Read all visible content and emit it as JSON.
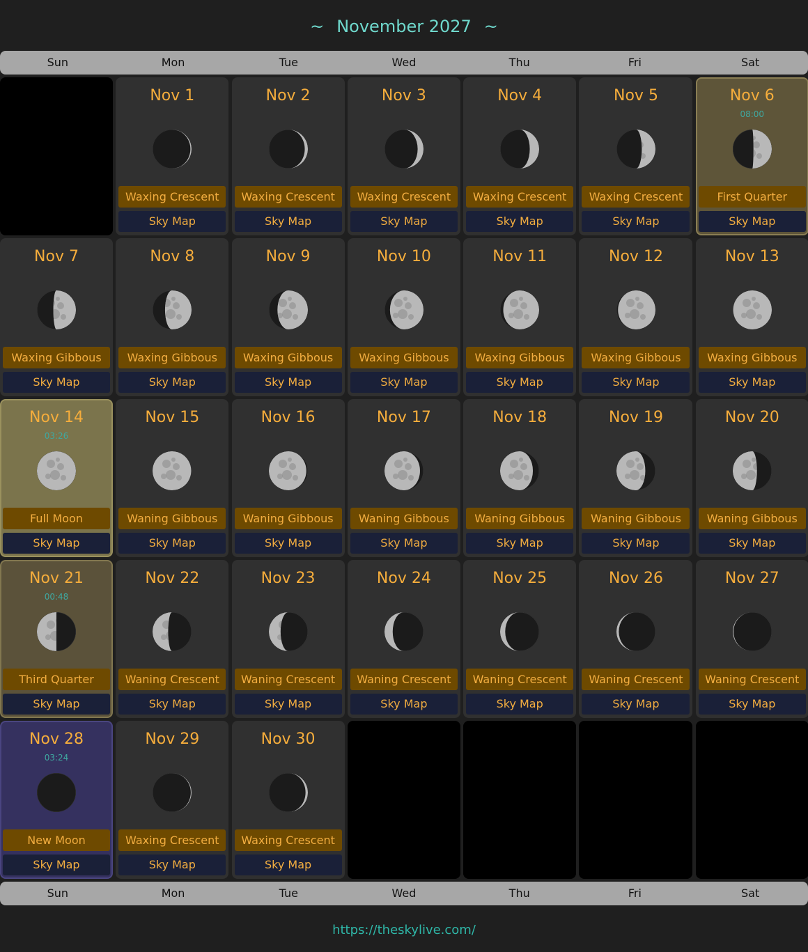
{
  "header": {
    "tilde": "~",
    "title": "November 2027"
  },
  "weekdays": [
    "Sun",
    "Mon",
    "Tue",
    "Wed",
    "Thu",
    "Fri",
    "Sat"
  ],
  "sky_label": "Sky Map",
  "leading_blanks": 1,
  "trailing_blanks": 4,
  "days": [
    {
      "date": "Nov 1",
      "phase": "Waxing Crescent",
      "illum": 0.03,
      "waxing": true
    },
    {
      "date": "Nov 2",
      "phase": "Waxing Crescent",
      "illum": 0.08,
      "waxing": true
    },
    {
      "date": "Nov 3",
      "phase": "Waxing Crescent",
      "illum": 0.15,
      "waxing": true
    },
    {
      "date": "Nov 4",
      "phase": "Waxing Crescent",
      "illum": 0.24,
      "waxing": true
    },
    {
      "date": "Nov 5",
      "phase": "Waxing Crescent",
      "illum": 0.35,
      "waxing": true
    },
    {
      "date": "Nov 6",
      "phase": "First Quarter",
      "illum": 0.47,
      "waxing": true,
      "time": "08:00",
      "kind": "fq"
    },
    {
      "date": "Nov 7",
      "phase": "Waxing Gibbous",
      "illum": 0.58,
      "waxing": true
    },
    {
      "date": "Nov 8",
      "phase": "Waxing Gibbous",
      "illum": 0.68,
      "waxing": true
    },
    {
      "date": "Nov 9",
      "phase": "Waxing Gibbous",
      "illum": 0.78,
      "waxing": true
    },
    {
      "date": "Nov 10",
      "phase": "Waxing Gibbous",
      "illum": 0.86,
      "waxing": true
    },
    {
      "date": "Nov 11",
      "phase": "Waxing Gibbous",
      "illum": 0.92,
      "waxing": true
    },
    {
      "date": "Nov 12",
      "phase": "Waxing Gibbous",
      "illum": 0.96,
      "waxing": true
    },
    {
      "date": "Nov 13",
      "phase": "Waxing Gibbous",
      "illum": 0.99,
      "waxing": true
    },
    {
      "date": "Nov 14",
      "phase": "Full Moon",
      "illum": 1.0,
      "waxing": true,
      "time": "03:26",
      "kind": "full"
    },
    {
      "date": "Nov 15",
      "phase": "Waning Gibbous",
      "illum": 0.99,
      "waxing": false
    },
    {
      "date": "Nov 16",
      "phase": "Waning Gibbous",
      "illum": 0.96,
      "waxing": false
    },
    {
      "date": "Nov 17",
      "phase": "Waning Gibbous",
      "illum": 0.91,
      "waxing": false
    },
    {
      "date": "Nov 18",
      "phase": "Waning Gibbous",
      "illum": 0.84,
      "waxing": false
    },
    {
      "date": "Nov 19",
      "phase": "Waning Gibbous",
      "illum": 0.74,
      "waxing": false
    },
    {
      "date": "Nov 20",
      "phase": "Waning Gibbous",
      "illum": 0.62,
      "waxing": false
    },
    {
      "date": "Nov 21",
      "phase": "Third Quarter",
      "illum": 0.5,
      "waxing": false,
      "time": "00:48",
      "kind": "tq"
    },
    {
      "date": "Nov 22",
      "phase": "Waning Crescent",
      "illum": 0.4,
      "waxing": false
    },
    {
      "date": "Nov 23",
      "phase": "Waning Crescent",
      "illum": 0.3,
      "waxing": false
    },
    {
      "date": "Nov 24",
      "phase": "Waning Crescent",
      "illum": 0.21,
      "waxing": false
    },
    {
      "date": "Nov 25",
      "phase": "Waning Crescent",
      "illum": 0.13,
      "waxing": false
    },
    {
      "date": "Nov 26",
      "phase": "Waning Crescent",
      "illum": 0.06,
      "waxing": false
    },
    {
      "date": "Nov 27",
      "phase": "Waning Crescent",
      "illum": 0.02,
      "waxing": false
    },
    {
      "date": "Nov 28",
      "phase": "New Moon",
      "illum": 0.0,
      "waxing": true,
      "time": "03:24",
      "kind": "new"
    },
    {
      "date": "Nov 29",
      "phase": "Waxing Crescent",
      "illum": 0.02,
      "waxing": true
    },
    {
      "date": "Nov 30",
      "phase": "Waxing Crescent",
      "illum": 0.06,
      "waxing": true
    }
  ],
  "footer": {
    "link": "https://theskylive.com/"
  }
}
